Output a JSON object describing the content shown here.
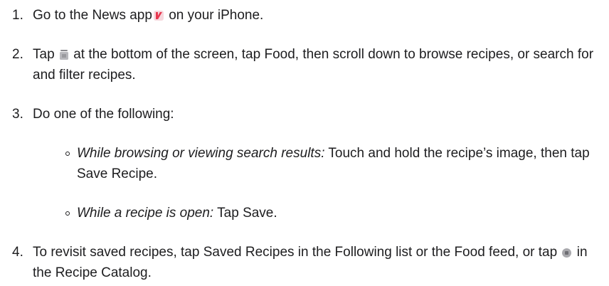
{
  "steps": [
    {
      "number": "1.",
      "before_icon": "Go to the News app",
      "icon": "news-app-icon",
      "after_icon": " on your iPhone."
    },
    {
      "number": "2.",
      "before_icon": "Tap",
      "icon": "following-tab-icon",
      "after_icon": " at the bottom of the screen, tap Food, then scroll down to browse recipes, or search for and filter recipes."
    },
    {
      "number": "3.",
      "text": "Do one of the following:",
      "sub_items": [
        {
          "italic": "While browsing or viewing search results:",
          "text": " Touch and hold the recipe’s image, then tap Save Recipe."
        },
        {
          "italic": "While a recipe is open:",
          "text": " Tap Save."
        }
      ]
    },
    {
      "number": "4.",
      "before_icon": "To revisit saved recipes, tap Saved Recipes in the Following list or the Food feed, or tap",
      "icon": "saved-recipes-icon",
      "after_icon": " in the Recipe Catalog."
    }
  ]
}
